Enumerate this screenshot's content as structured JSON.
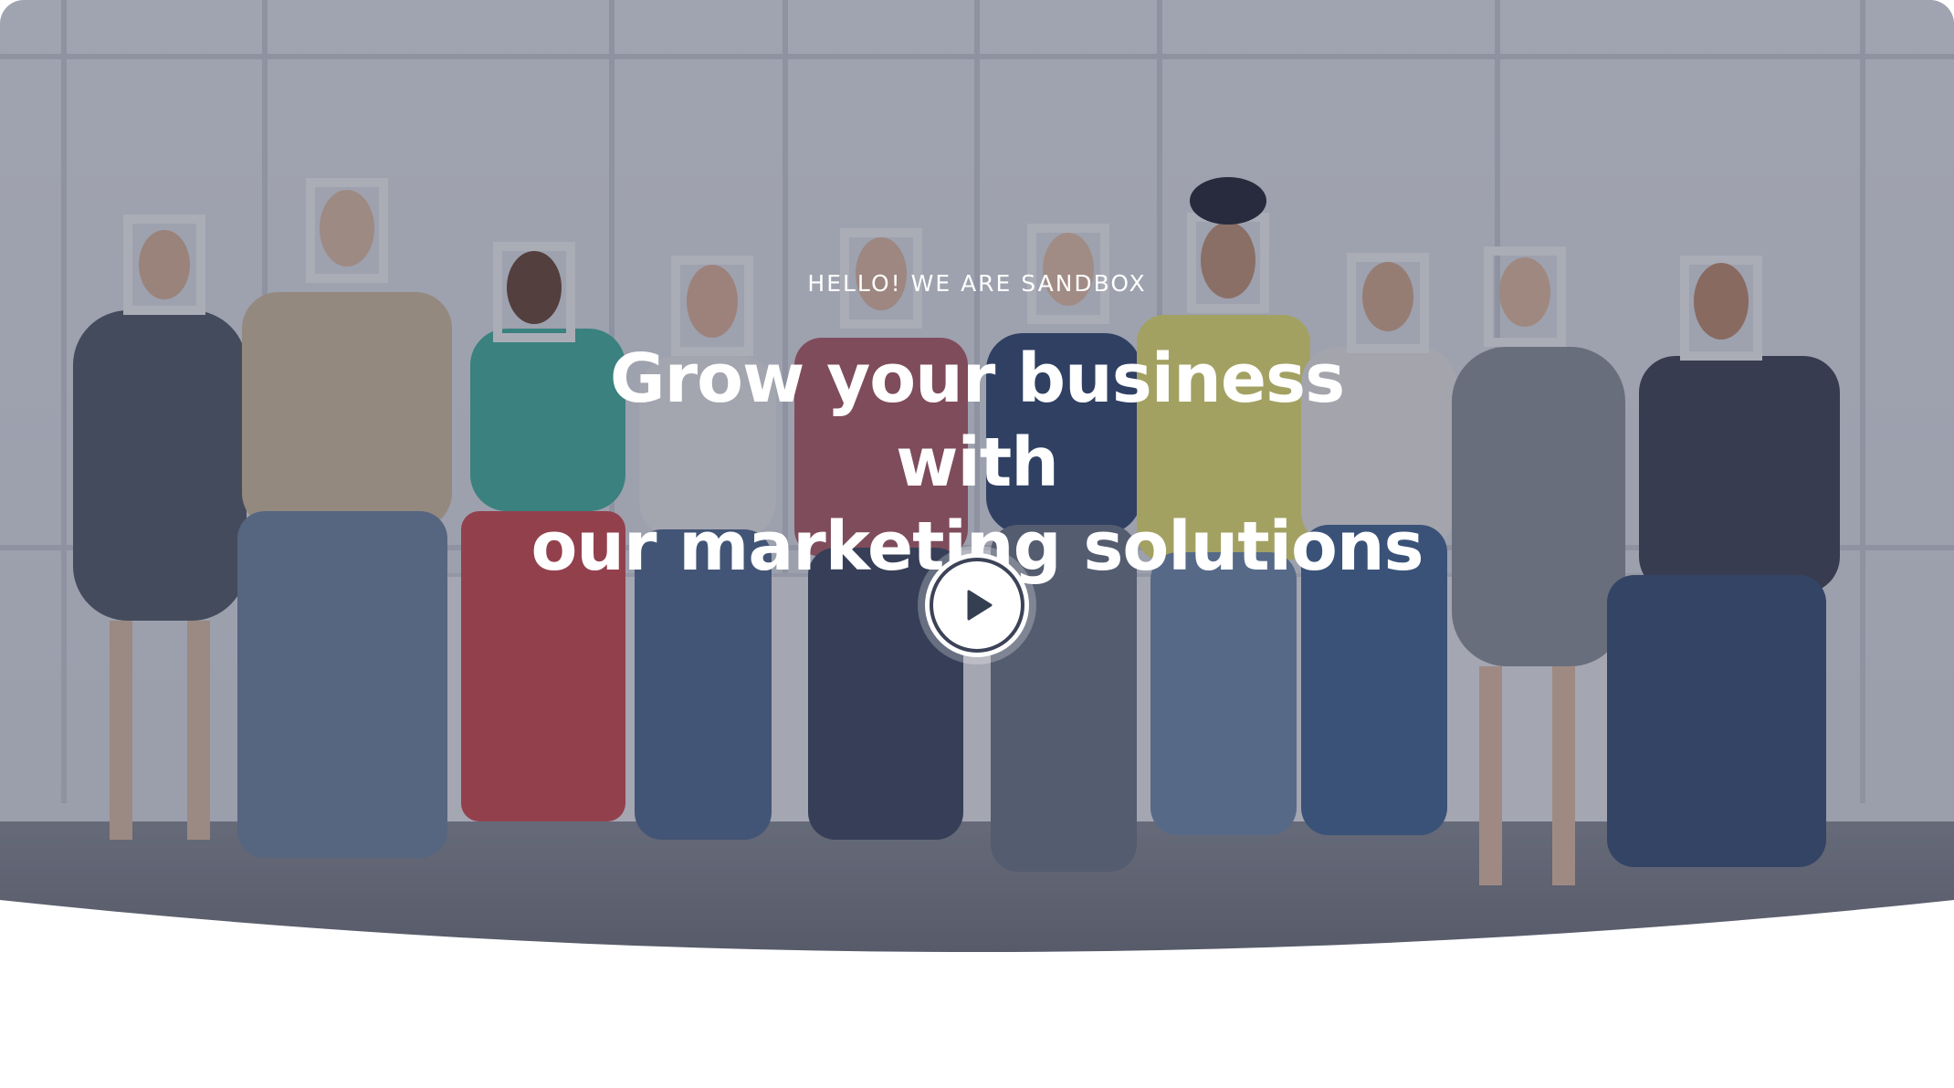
{
  "hero": {
    "eyebrow": "HELLO! WE ARE SANDBOX",
    "headline_line1": "Grow your business with",
    "headline_line2": "our marketing solutions",
    "play_button_icon": "play-icon",
    "overlay_color": "#343a50"
  }
}
